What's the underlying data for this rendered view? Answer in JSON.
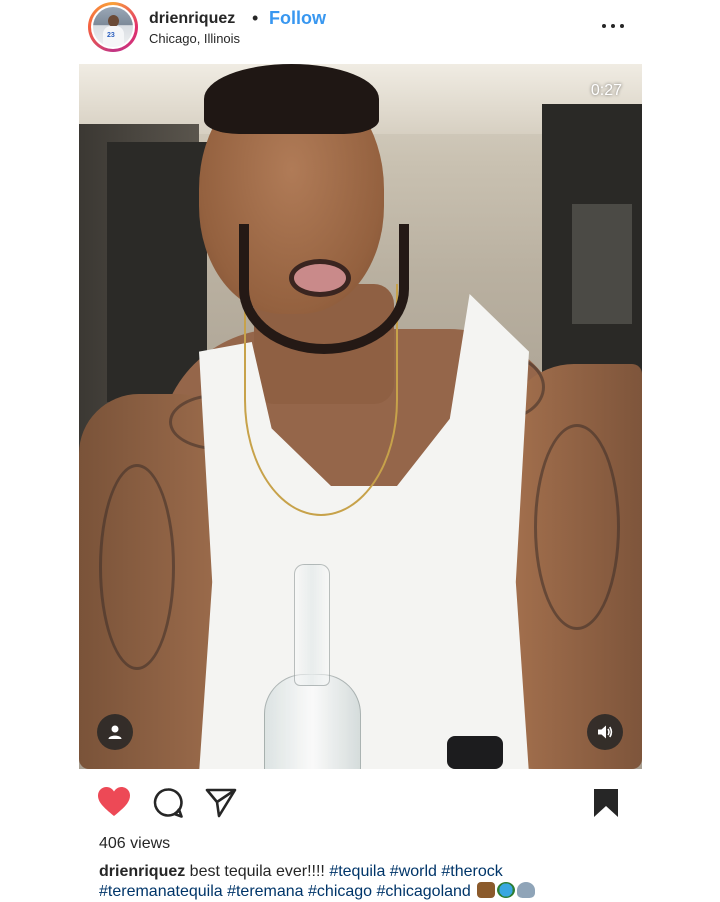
{
  "header": {
    "username": "drienriquez",
    "separator": "•",
    "follow_label": "Follow",
    "location": "Chicago, Illinois",
    "more_icon": "more-horizontal-icon"
  },
  "video": {
    "timer": "0:27",
    "tag_icon": "user-tag-icon",
    "sound_icon": "speaker-icon"
  },
  "actions": {
    "like_icon": "heart-icon",
    "comment_icon": "comment-icon",
    "share_icon": "send-icon",
    "save_icon": "bookmark-icon",
    "like_color": "#ed4956"
  },
  "post": {
    "views": "406 views",
    "caption_user": "drienriquez",
    "caption_text": " best tequila ever!!!! ",
    "caption_tags_line1": "#tequila #world #therock",
    "caption_tags_line2": "#teremanatequila #teremana #chicago #chicagoland",
    "emojis": [
      "flexed-biceps-emoji",
      "globe-emoji",
      "speaking-head-emoji"
    ]
  },
  "colors": {
    "accent": "#3897f0",
    "text": "#262626",
    "hashtag": "#003569"
  }
}
